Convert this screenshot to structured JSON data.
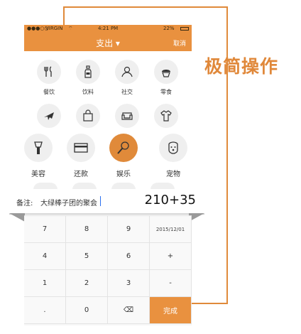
{
  "callout": {
    "text": "极简操作"
  },
  "status": {
    "carrier": "VIRGIN",
    "time": "4:21 PM",
    "battery": "22%"
  },
  "nav": {
    "title": "支出",
    "title_arrow": "▾",
    "cancel": "取消"
  },
  "row1": [
    {
      "label": "餐饮",
      "icon": "utensils-icon"
    },
    {
      "label": "饮料",
      "icon": "bottle-icon"
    },
    {
      "label": "社交",
      "icon": "handshake-icon"
    },
    {
      "label": "零食",
      "icon": "cupcake-icon"
    }
  ],
  "row2": [
    {
      "label": "",
      "icon": "airplane-icon"
    },
    {
      "label": "",
      "icon": "shopping-bag-icon"
    },
    {
      "label": "",
      "icon": "sofa-icon"
    },
    {
      "label": "",
      "icon": "tshirt-icon"
    }
  ],
  "row3": [
    {
      "label": "美容",
      "icon": "makeup-brush-icon"
    },
    {
      "label": "还款",
      "icon": "credit-card-icon"
    },
    {
      "label": "娱乐",
      "icon": "microphone-icon",
      "selected": true
    },
    {
      "label": "宠物",
      "icon": "dog-icon"
    }
  ],
  "note": {
    "label": "备注:",
    "value": "大绿棒子团的聚会",
    "amount": "210+35"
  },
  "keypad": {
    "r1": [
      "7",
      "8",
      "9",
      "2015/12/01"
    ],
    "r2": [
      "4",
      "5",
      "6",
      "+"
    ],
    "r3": [
      "1",
      "2",
      "3",
      "-"
    ],
    "r4": [
      ".",
      "0",
      "⌫",
      "完成"
    ]
  },
  "colors": {
    "accent": "#e9913f"
  }
}
